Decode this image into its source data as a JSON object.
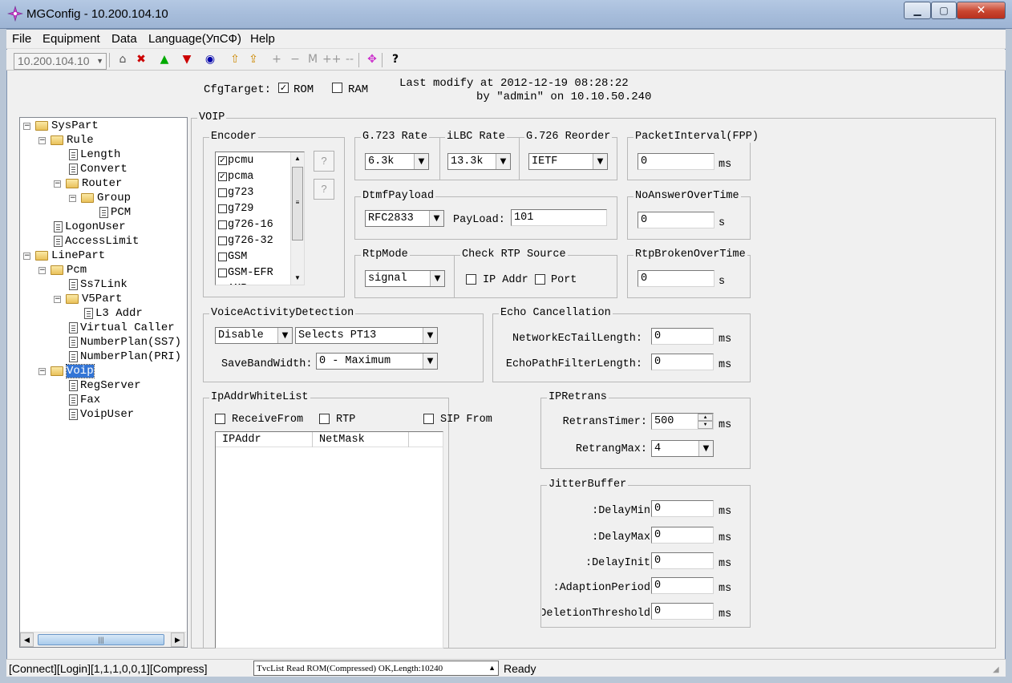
{
  "window": {
    "title": "MGConfig - 10.200.104.10"
  },
  "menu": [
    "File",
    "Equipment",
    "Data",
    "Language(УпСФ)",
    "Help"
  ],
  "toolbar": {
    "address": "10.200.104.10"
  },
  "cfg": {
    "label": "CfgTarget:",
    "rom_label": "ROM",
    "rom_checked": true,
    "ram_label": "RAM",
    "ram_checked": false,
    "modify_line1": "Last modify at 2012-12-19 08:28:22",
    "modify_line2": "by \"admin\" on 10.10.50.240"
  },
  "tree": {
    "nodes": [
      {
        "label": "SysPart",
        "type": "folder",
        "level": 0,
        "expand": "−"
      },
      {
        "label": "Rule",
        "type": "folder",
        "level": 1,
        "expand": "−"
      },
      {
        "label": "Length",
        "type": "doc",
        "level": 2,
        "expand": ""
      },
      {
        "label": "Convert",
        "type": "doc",
        "level": 2,
        "expand": ""
      },
      {
        "label": "Router",
        "type": "folder",
        "level": 2,
        "expand": "−"
      },
      {
        "label": "Group",
        "type": "folder",
        "level": 3,
        "expand": "−"
      },
      {
        "label": "PCM",
        "type": "doc",
        "level": 4,
        "expand": ""
      },
      {
        "label": "LogonUser",
        "type": "doc",
        "level": 1,
        "expand": ""
      },
      {
        "label": "AccessLimit",
        "type": "doc",
        "level": 1,
        "expand": ""
      },
      {
        "label": "LinePart",
        "type": "folder",
        "level": 0,
        "expand": "−"
      },
      {
        "label": "Pcm",
        "type": "folder",
        "level": 1,
        "expand": "−"
      },
      {
        "label": "Ss7Link",
        "type": "doc",
        "level": 2,
        "expand": ""
      },
      {
        "label": "V5Part",
        "type": "folder",
        "level": 2,
        "expand": "−"
      },
      {
        "label": "L3 Addr",
        "type": "doc",
        "level": 3,
        "expand": ""
      },
      {
        "label": "Virtual Caller",
        "type": "doc",
        "level": 2,
        "expand": ""
      },
      {
        "label": "NumberPlan(SS7)",
        "type": "doc",
        "level": 2,
        "expand": ""
      },
      {
        "label": "NumberPlan(PRI)",
        "type": "doc",
        "level": 2,
        "expand": ""
      },
      {
        "label": "Voip",
        "type": "folder-open",
        "level": 1,
        "expand": "−",
        "selected": true
      },
      {
        "label": "RegServer",
        "type": "doc",
        "level": 2,
        "expand": ""
      },
      {
        "label": "Fax",
        "type": "doc",
        "level": 2,
        "expand": ""
      },
      {
        "label": "VoipUser",
        "type": "doc",
        "level": 2,
        "expand": ""
      }
    ]
  },
  "voip": {
    "title": "VOIP",
    "encoder": {
      "label": "Encoder",
      "items": [
        {
          "name": "pcmu",
          "checked": true
        },
        {
          "name": "pcma",
          "checked": true
        },
        {
          "name": "g723",
          "checked": false
        },
        {
          "name": "g729",
          "checked": false
        },
        {
          "name": "g726-16",
          "checked": false
        },
        {
          "name": "g726-32",
          "checked": false
        },
        {
          "name": "GSM",
          "checked": false
        },
        {
          "name": "GSM-EFR",
          "checked": false
        },
        {
          "name": "AMR",
          "checked": false
        }
      ],
      "btn": "?"
    },
    "g723": {
      "label": "G.723 Rate",
      "value": "6.3k"
    },
    "ilbc": {
      "label": "iLBC Rate",
      "value": "13.3k"
    },
    "g726": {
      "label": "G.726 Reorder",
      "value": "IETF"
    },
    "packet_interval": {
      "label": "PacketInterval(FPP)",
      "value": "0",
      "unit": "ms"
    },
    "dtmf": {
      "label": "DtmfPayload",
      "value": "RFC2833",
      "payload_label": "PayLoad:",
      "payload": "101"
    },
    "no_answer": {
      "label": "NoAnswerOverTime",
      "value": "0",
      "unit": "s"
    },
    "rtp_mode": {
      "label": "RtpMode",
      "value": "signal"
    },
    "check_rtp": {
      "label": "Check RTP Source",
      "ip_label": "IP Addr",
      "ip_checked": false,
      "port_label": "Port",
      "port_checked": false
    },
    "rtp_broken": {
      "label": "RtpBrokenOverTime",
      "value": "0",
      "unit": "s"
    },
    "vad": {
      "label": "VoiceActivityDetection",
      "mode": "Disable",
      "selects": "Selects PT13",
      "save_label": "SaveBandWidth:",
      "save_value": "0 - Maximum"
    },
    "echo": {
      "label": "Echo Cancellation",
      "tail_label": "NetworkEcTailLength:",
      "tail": "0",
      "filter_label": "EchoPathFilterLength:",
      "filter": "0",
      "unit": "ms"
    },
    "whitelist": {
      "label": "IpAddrWhiteList",
      "receive_label": "ReceiveFrom",
      "receive_checked": false,
      "rtp_label": "RTP",
      "rtp_checked": false,
      "sip_label": "SIP From",
      "sip_checked": false,
      "columns": [
        "IPAddr",
        "NetMask"
      ]
    },
    "ipretrans": {
      "label": "IPRetrans",
      "timer_label": "RetransTimer:",
      "timer": "500",
      "max_label": "RetrangMax:",
      "max": "4",
      "unit": "ms"
    },
    "jitter": {
      "label": "JitterBuffer",
      "unit": "ms",
      "rows": [
        {
          "label": "DelayMin:",
          "value": "0"
        },
        {
          "label": "DelayMax:",
          "value": "0"
        },
        {
          "label": "DelayInit:",
          "value": "0"
        },
        {
          "label": "AdaptionPeriod:",
          "value": "0"
        },
        {
          "label": "DeletionThreshold:",
          "value": "0"
        }
      ]
    }
  },
  "status": {
    "left": "[Connect][Login][1,1,1,0,0,1][Compress]",
    "mid": "TvcList Read ROM(Compressed) OK,Length:10240",
    "right": "Ready"
  }
}
